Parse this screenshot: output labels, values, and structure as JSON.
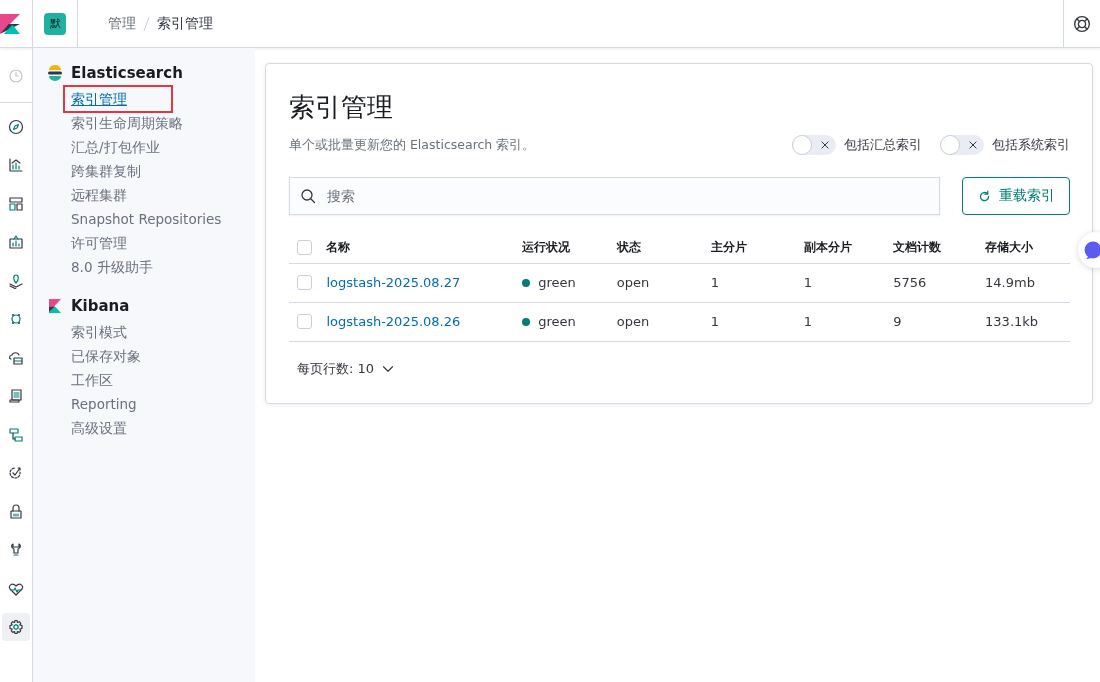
{
  "header": {
    "avatar": "默",
    "breadcrumbs": [
      {
        "label": "管理",
        "selected": false
      },
      {
        "label": "索引管理",
        "selected": true
      }
    ]
  },
  "nav": [
    {
      "selected": false
    },
    {
      "selected": false
    },
    {
      "selected": false
    },
    {
      "selected": false
    },
    {
      "selected": false
    },
    {
      "selected": false
    },
    {
      "selected": false
    },
    {
      "selected": false
    },
    {
      "selected": false
    },
    {
      "selected": false
    },
    {
      "selected": false
    },
    {
      "selected": false
    },
    {
      "selected": false
    },
    {
      "selected": false
    },
    {
      "selected": true
    }
  ],
  "sidebar": [
    {
      "title": "Elasticsearch",
      "kind": "elasticsearch",
      "items": [
        {
          "label": "索引管理",
          "selected": true
        },
        {
          "label": "索引生命周期策略",
          "selected": false
        },
        {
          "label": "汇总/打包作业",
          "selected": false
        },
        {
          "label": "跨集群复制",
          "selected": false
        },
        {
          "label": "远程集群",
          "selected": false
        },
        {
          "label": "Snapshot Repositories",
          "selected": false
        },
        {
          "label": "许可管理",
          "selected": false
        },
        {
          "label": "8.0 升级助手",
          "selected": false
        }
      ]
    },
    {
      "title": "Kibana",
      "kind": "kibana",
      "items": [
        {
          "label": "索引模式",
          "selected": false
        },
        {
          "label": "已保存对象",
          "selected": false
        },
        {
          "label": "工作区",
          "selected": false
        },
        {
          "label": "Reporting",
          "selected": false
        },
        {
          "label": "高级设置",
          "selected": false
        }
      ]
    }
  ],
  "page": {
    "title": "索引管理",
    "description": "单个或批量更新您的 Elasticsearch 索引。",
    "toggles": [
      {
        "label": "包括汇总索引",
        "on": false
      },
      {
        "label": "包括系统索引",
        "on": false
      }
    ],
    "search": {
      "placeholder": "搜索"
    },
    "reload_button": "重载索引",
    "table": {
      "columns": [
        "名称",
        "运行状况",
        "状态",
        "主分片",
        "副本分片",
        "文档计数",
        "存储大小"
      ],
      "all_checked": false,
      "rows": [
        {
          "checked": false,
          "name": "logstash-2025.08.27",
          "health": "green",
          "color": "#017d73",
          "status": "open",
          "primaries": "1",
          "replicas": "1",
          "docs": "5756",
          "size": "14.9mb"
        },
        {
          "checked": false,
          "name": "logstash-2025.08.26",
          "health": "green",
          "color": "#017d73",
          "status": "open",
          "primaries": "1",
          "replicas": "1",
          "docs": "9",
          "size": "133.1kb"
        }
      ]
    },
    "rows_per_page": "每页行数: 10"
  }
}
